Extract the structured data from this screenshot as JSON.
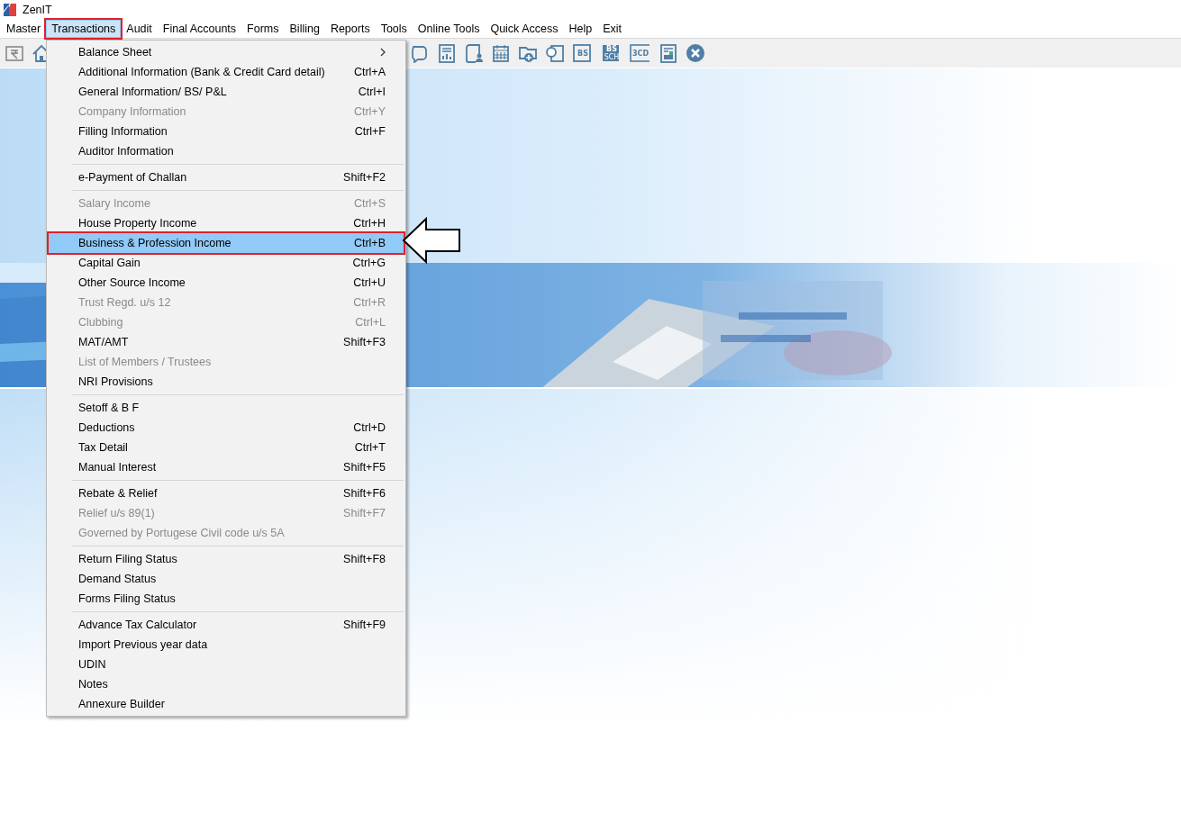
{
  "window": {
    "title": "ZenIT"
  },
  "menubar": [
    {
      "label": "Master",
      "selected": false,
      "annotated": false
    },
    {
      "label": "Transactions",
      "selected": true,
      "annotated": true
    },
    {
      "label": "Audit",
      "selected": false,
      "annotated": false
    },
    {
      "label": "Final Accounts",
      "selected": false,
      "annotated": false
    },
    {
      "label": "Forms",
      "selected": false,
      "annotated": false
    },
    {
      "label": "Billing",
      "selected": false,
      "annotated": false
    },
    {
      "label": "Reports",
      "selected": false,
      "annotated": false
    },
    {
      "label": "Tools",
      "selected": false,
      "annotated": false
    },
    {
      "label": "Online Tools",
      "selected": false,
      "annotated": false
    },
    {
      "label": "Quick Access",
      "selected": false,
      "annotated": false
    },
    {
      "label": "Help",
      "selected": false,
      "annotated": false
    },
    {
      "label": "Exit",
      "selected": false,
      "annotated": false
    }
  ],
  "toolbar": [
    {
      "kind": "rupee"
    },
    {
      "kind": "home"
    },
    {
      "kind": "chat"
    },
    {
      "kind": "report"
    },
    {
      "kind": "user-book"
    },
    {
      "kind": "calendar"
    },
    {
      "kind": "folder-add"
    },
    {
      "kind": "copy"
    },
    {
      "kind": "bs",
      "label": "BS"
    },
    {
      "kind": "bs-sch",
      "label": "BS",
      "sublabel": "SCH"
    },
    {
      "kind": "doc",
      "label": "3CD"
    },
    {
      "kind": "form"
    },
    {
      "kind": "close"
    }
  ],
  "dropdown": [
    {
      "kind": "item",
      "label": "Balance Sheet",
      "submenu": true,
      "disabled": false,
      "selected": false,
      "annotated": false
    },
    {
      "kind": "item",
      "label": "Additional Information (Bank & Credit Card detail)",
      "shortcut": "Ctrl+A",
      "disabled": false,
      "selected": false,
      "annotated": false
    },
    {
      "kind": "item",
      "label": "General Information/ BS/ P&L",
      "shortcut": "Ctrl+I",
      "disabled": false,
      "selected": false,
      "annotated": false
    },
    {
      "kind": "item",
      "label": "Company Information",
      "shortcut": "Ctrl+Y",
      "disabled": true,
      "selected": false,
      "annotated": false
    },
    {
      "kind": "item",
      "label": "Filling Information",
      "shortcut": "Ctrl+F",
      "disabled": false,
      "selected": false,
      "annotated": false
    },
    {
      "kind": "item",
      "label": "Auditor Information",
      "disabled": false,
      "selected": false,
      "annotated": false
    },
    {
      "kind": "separator"
    },
    {
      "kind": "item",
      "label": "e-Payment of Challan",
      "shortcut": "Shift+F2",
      "disabled": false,
      "selected": false,
      "annotated": false
    },
    {
      "kind": "separator"
    },
    {
      "kind": "item",
      "label": "Salary Income",
      "shortcut": "Ctrl+S",
      "disabled": true,
      "selected": false,
      "annotated": false
    },
    {
      "kind": "item",
      "label": "House Property Income",
      "shortcut": "Ctrl+H",
      "disabled": false,
      "selected": false,
      "annotated": false
    },
    {
      "kind": "item",
      "label": "Business & Profession Income",
      "shortcut": "Ctrl+B",
      "disabled": false,
      "selected": true,
      "annotated": true
    },
    {
      "kind": "item",
      "label": "Capital Gain",
      "shortcut": "Ctrl+G",
      "disabled": false,
      "selected": false,
      "annotated": false
    },
    {
      "kind": "item",
      "label": "Other Source Income",
      "shortcut": "Ctrl+U",
      "disabled": false,
      "selected": false,
      "annotated": false
    },
    {
      "kind": "item",
      "label": "Trust Regd. u/s 12",
      "shortcut": "Ctrl+R",
      "disabled": true,
      "selected": false,
      "annotated": false
    },
    {
      "kind": "item",
      "label": "Clubbing",
      "shortcut": "Ctrl+L",
      "disabled": true,
      "selected": false,
      "annotated": false
    },
    {
      "kind": "item",
      "label": "MAT/AMT",
      "shortcut": "Shift+F3",
      "disabled": false,
      "selected": false,
      "annotated": false
    },
    {
      "kind": "item",
      "label": "List of Members / Trustees",
      "disabled": true,
      "selected": false,
      "annotated": false
    },
    {
      "kind": "item",
      "label": "NRI Provisions",
      "disabled": false,
      "selected": false,
      "annotated": false
    },
    {
      "kind": "separator"
    },
    {
      "kind": "item",
      "label": "Setoff & B F",
      "disabled": false,
      "selected": false,
      "annotated": false
    },
    {
      "kind": "item",
      "label": "Deductions",
      "shortcut": "Ctrl+D",
      "disabled": false,
      "selected": false,
      "annotated": false
    },
    {
      "kind": "item",
      "label": "Tax Detail",
      "shortcut": "Ctrl+T",
      "disabled": false,
      "selected": false,
      "annotated": false
    },
    {
      "kind": "item",
      "label": "Manual Interest",
      "shortcut": "Shift+F5",
      "disabled": false,
      "selected": false,
      "annotated": false
    },
    {
      "kind": "separator"
    },
    {
      "kind": "item",
      "label": "Rebate & Relief",
      "shortcut": "Shift+F6",
      "disabled": false,
      "selected": false,
      "annotated": false
    },
    {
      "kind": "item",
      "label": "Relief u/s 89(1)",
      "shortcut": "Shift+F7",
      "disabled": true,
      "selected": false,
      "annotated": false
    },
    {
      "kind": "item",
      "label": "Governed by Portugese Civil code u/s 5A",
      "disabled": true,
      "selected": false,
      "annotated": false
    },
    {
      "kind": "separator"
    },
    {
      "kind": "item",
      "label": "Return Filing Status",
      "shortcut": "Shift+F8",
      "disabled": false,
      "selected": false,
      "annotated": false
    },
    {
      "kind": "item",
      "label": "Demand Status",
      "disabled": false,
      "selected": false,
      "annotated": false
    },
    {
      "kind": "item",
      "label": "Forms Filing Status",
      "disabled": false,
      "selected": false,
      "annotated": false
    },
    {
      "kind": "separator"
    },
    {
      "kind": "item",
      "label": "Advance Tax Calculator",
      "shortcut": "Shift+F9",
      "disabled": false,
      "selected": false,
      "annotated": false
    },
    {
      "kind": "item",
      "label": "Import Previous year data",
      "disabled": false,
      "selected": false,
      "annotated": false
    },
    {
      "kind": "item",
      "label": "UDIN",
      "disabled": false,
      "selected": false,
      "annotated": false
    },
    {
      "kind": "item",
      "label": "Notes",
      "disabled": false,
      "selected": false,
      "annotated": false
    },
    {
      "kind": "item",
      "label": "Annexure Builder",
      "disabled": false,
      "selected": false,
      "annotated": false
    }
  ]
}
